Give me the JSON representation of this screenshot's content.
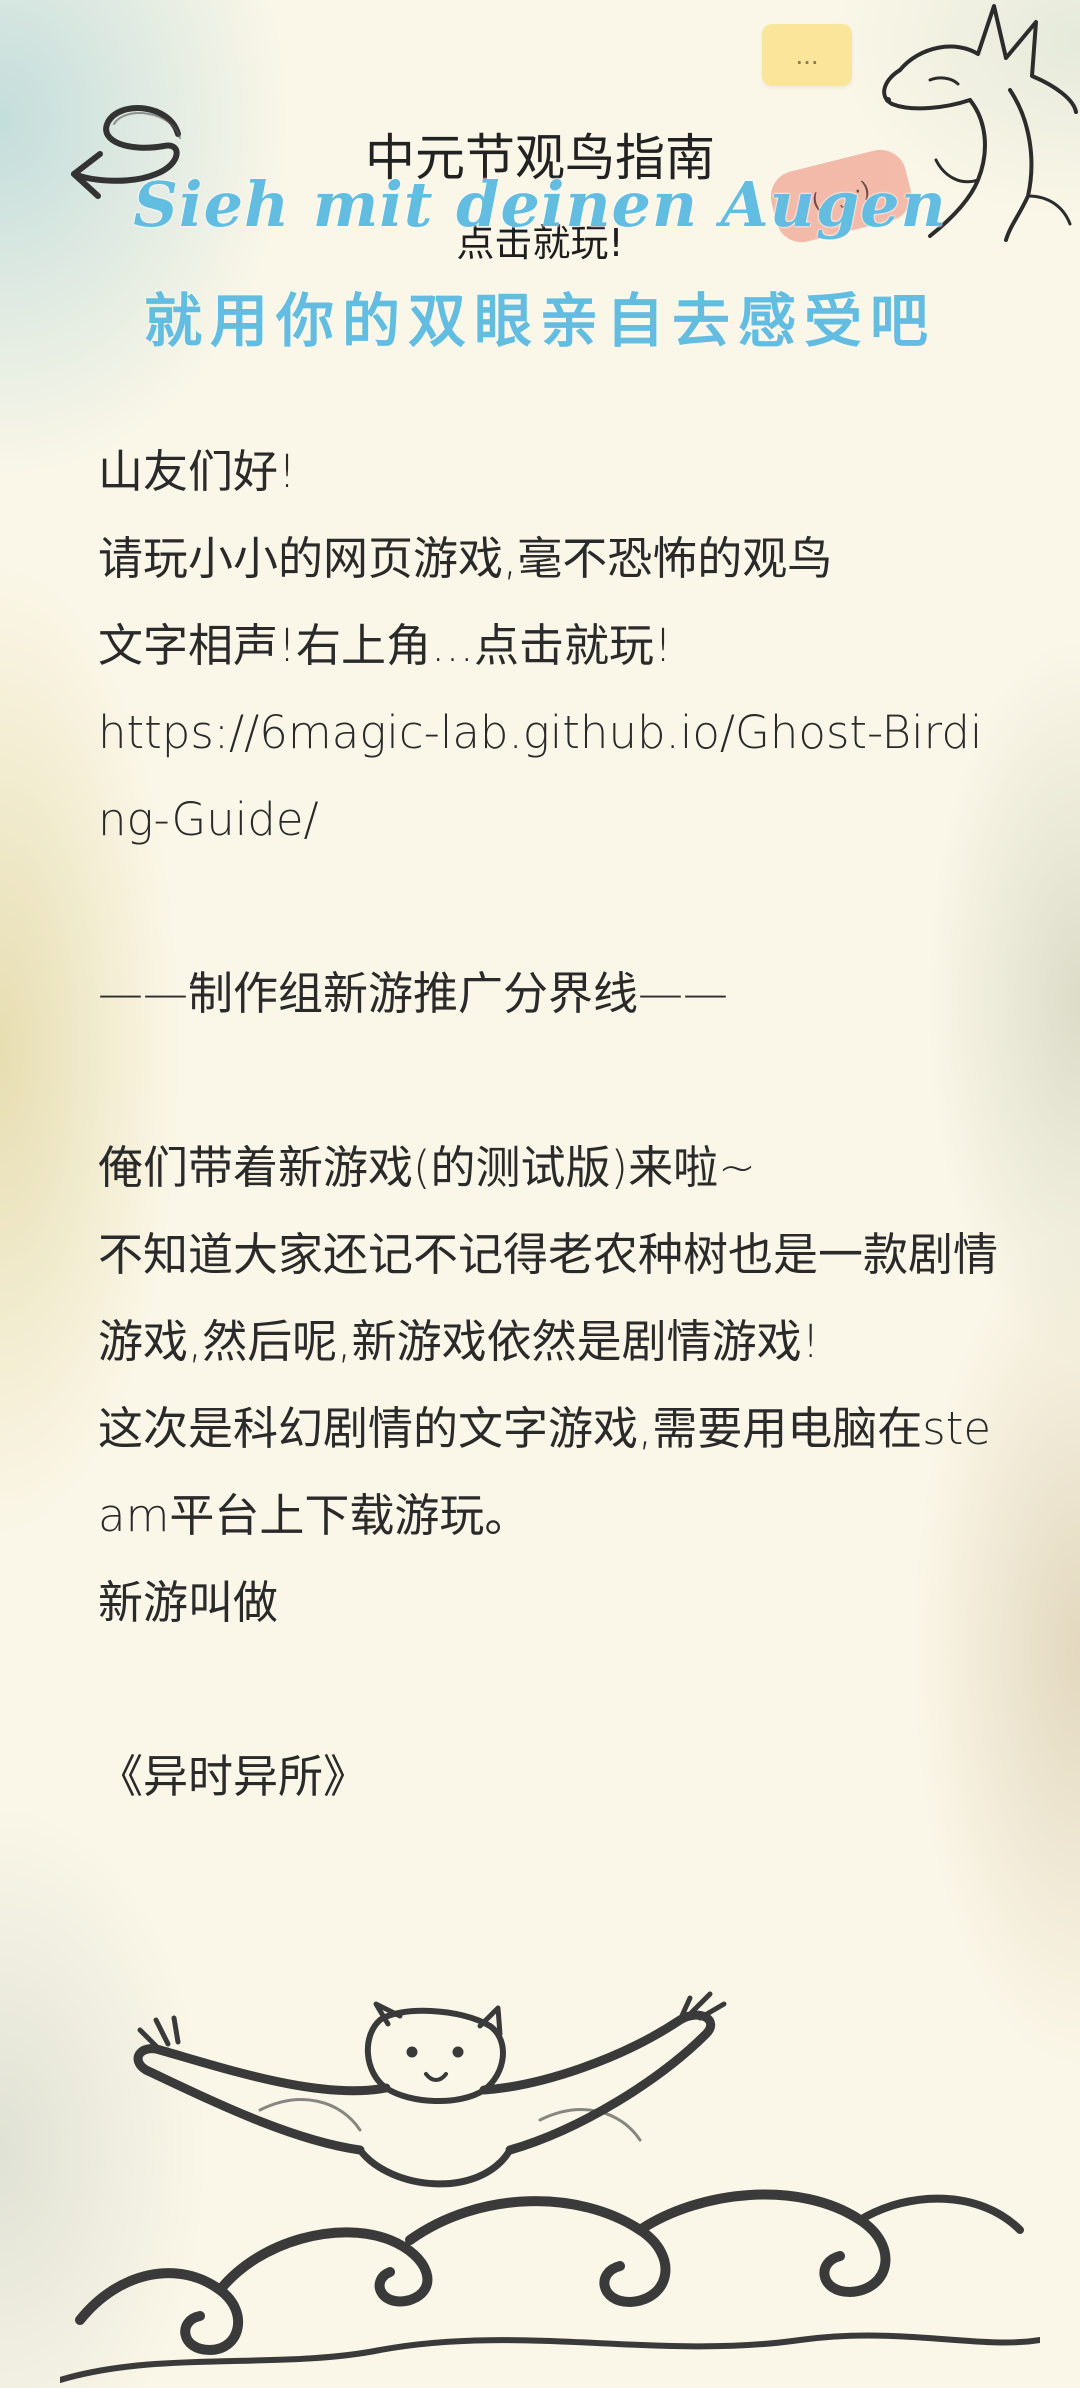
{
  "header": {
    "title": "中元节观鸟指南",
    "play_hint": "点击就玩!",
    "tagline_de": "Sieh mit deinen Augen",
    "tagline_zh": "就用你的双眼亲自去感受吧",
    "menu_label": "...",
    "emoticon": "( ·  ·̫ ·)"
  },
  "article": {
    "greeting": "山友们好!",
    "intro_line1": "请玩小小的网页游戏,毫不恐怖的观鸟",
    "intro_line2": "文字相声!右上角...点击就玩!",
    "link": "https://6magic-lab.github.io/Ghost-Birding-Guide/",
    "divider": "——制作组新游推广分界线——",
    "p1": "俺们带着新游戏(的测试版)来啦~",
    "p2": "不知道大家还记不记得老农种树也是一款剧情游戏,然后呢,新游戏依然是剧情游戏!",
    "p3": "这次是科幻剧情的文字游戏,需要用电脑在steam平台上下载游玩。",
    "p4": "新游叫做",
    "game_name": "《异时异所》"
  },
  "colors": {
    "accent_blue": "#63bde0",
    "bubble_pink": "#f3b3a3",
    "menu_yellow": "#fbe59a",
    "text": "#2a2a2a",
    "background": "#fbf7e8"
  },
  "icons": {
    "back": "hand-drawn-back-arrow-icon",
    "decor_top": "ink-fox-illustration",
    "decor_bottom": "ink-creature-on-waves-illustration"
  }
}
